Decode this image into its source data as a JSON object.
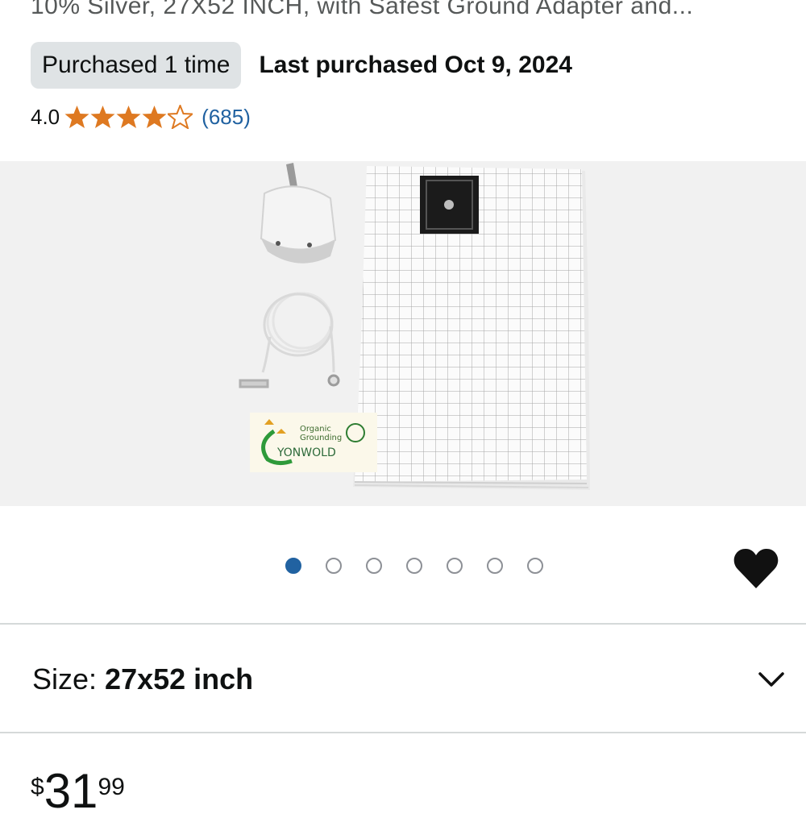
{
  "product": {
    "title_line": "10% Silver, 27X52 INCH, with Safest Ground Adapter and...",
    "purchased_badge": "Purchased 1 time",
    "last_purchased": "Last purchased Oct 9, 2024",
    "rating": {
      "value": "4.0",
      "stars": 4,
      "max_stars": 5,
      "count": "(685)"
    },
    "image": {
      "logo_line1": "Organic",
      "logo_line2": "Grounding",
      "logo_brand": "YONWOLD"
    },
    "carousel": {
      "total": 7,
      "active_index": 0
    },
    "size": {
      "label": "Size: ",
      "value": "27x52 inch"
    },
    "price": {
      "symbol": "$",
      "whole": "31",
      "fraction": "99"
    }
  },
  "colors": {
    "star": "#de7921",
    "link": "#2162a1",
    "pill_bg": "#dfe3e5",
    "dot_active": "#2162a1"
  },
  "icons": {
    "star": "star-icon",
    "heart": "heart-icon",
    "chevron": "chevron-down-icon"
  }
}
